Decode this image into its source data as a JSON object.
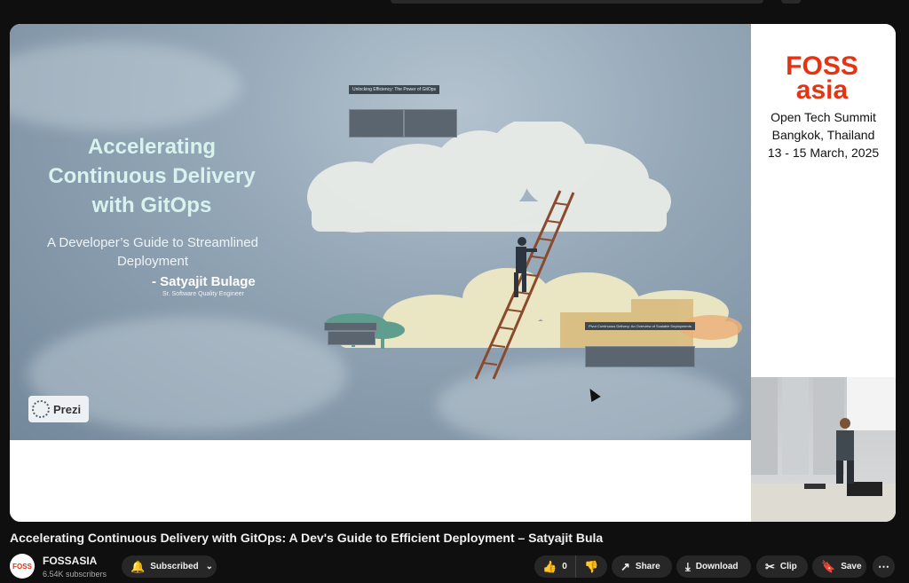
{
  "slide": {
    "title": "Accelerating Continuous Delivery with GitOps",
    "subtitle": "A Developer’s Guide to Streamlined Deployment",
    "presenter": "- Satyajit Bulage",
    "role": "Sr. Software Quality Engineer",
    "prezi_label": "Prezi",
    "panel_top_title": "Unlocking Efficiency: The Power of GitOps",
    "panel_bottom_title": "Pivot Continuous Delivery: An Overview of Scalable Deployments"
  },
  "sidebar": {
    "logo_line1": "FOSS",
    "logo_line2": "asia",
    "logo_color": "#e63312",
    "event_line1": "Open Tech Summit",
    "event_line2": "Bangkok, Thailand",
    "event_line3": "13 - 15 March, 2025"
  },
  "video": {
    "title": "Accelerating Continuous Delivery with GitOps: A Dev's Guide to Efficient Deployment – Satyajit Bula"
  },
  "channel": {
    "name": "FOSSASIA",
    "subscribers": "6.54K subscribers",
    "avatar_text": "FOSS"
  },
  "actions": {
    "subscribe_label": "Subscribed",
    "like_count": "0",
    "share_label": "Share",
    "download_label": "Download",
    "clip_label": "Clip",
    "save_label": "Save"
  }
}
